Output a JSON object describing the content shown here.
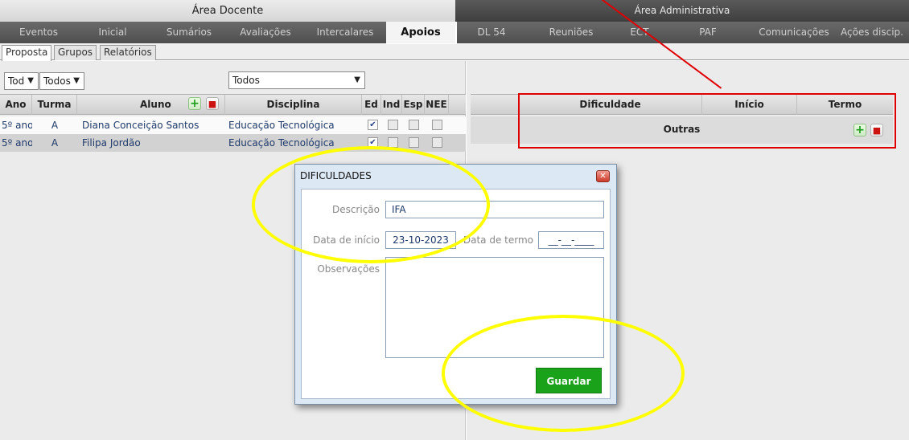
{
  "sections": {
    "docente": "Área Docente",
    "administrativa": "Área Administrativa"
  },
  "nav": {
    "items": [
      "Eventos",
      "Inicial",
      "Sumários",
      "Avaliações",
      "Intercalares",
      "Apoios",
      "DL 54",
      "Reuniões",
      "ECT",
      "PAF",
      "Comunicações",
      "Ações discip."
    ],
    "active": "Apoios"
  },
  "subtabs": {
    "items": [
      "Proposta",
      "Grupos",
      "Relatórios"
    ],
    "active": "Proposta"
  },
  "filters": {
    "ano": "Tod",
    "turma": "Todos",
    "disciplina": "Todos"
  },
  "left_table": {
    "headers": {
      "ano": "Ano",
      "turma": "Turma",
      "aluno": "Aluno",
      "disciplina": "Disciplina",
      "ed": "Ed",
      "ind": "Ind",
      "esp": "Esp",
      "nee": "NEE"
    },
    "rows": [
      {
        "ano": "5º ano",
        "turma": "A",
        "aluno": "Diana Conceição Santos",
        "disciplina": "Educação Tecnológica",
        "ed": true,
        "ind": false,
        "esp": false,
        "nee": false
      },
      {
        "ano": "5º ano",
        "turma": "A",
        "aluno": "Filipa Jordão",
        "disciplina": "Educação Tecnológica",
        "ed": true,
        "ind": false,
        "esp": false,
        "nee": false
      }
    ]
  },
  "right_table": {
    "headers": {
      "dificuldade": "Dificuldade",
      "inicio": "Início",
      "termo": "Termo"
    },
    "group_row": "Outras"
  },
  "dialog": {
    "title": "DIFICULDADES",
    "descricao_label": "Descrição",
    "descricao_value": "IFA",
    "data_inicio_label": "Data de início",
    "data_inicio_value": "23-10-2023",
    "data_termo_label": "Data de termo",
    "data_termo_value": "__-__-____",
    "observacoes_label": "Observações",
    "observacoes_value": "",
    "save_label": "Guardar"
  },
  "icons": {
    "add": "plus-icon",
    "delete": "trash-icon",
    "close": "close-icon",
    "dropdown": "chevron-down-icon",
    "check": "check-icon"
  },
  "colors": {
    "annotation_red": "#e00000",
    "annotation_yellow": "#ffff00",
    "save_green": "#1aa21a",
    "dialog_bg": "#dce8f4"
  }
}
